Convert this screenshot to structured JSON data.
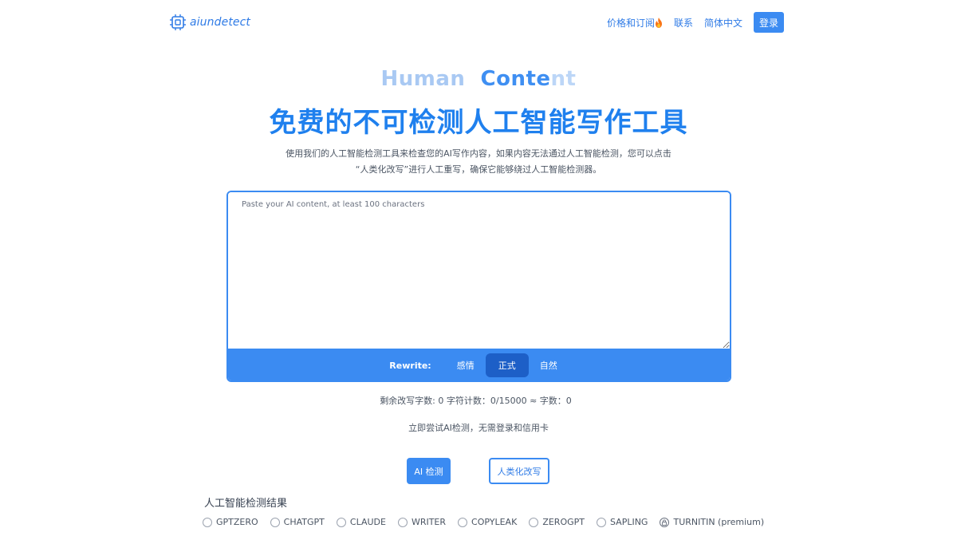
{
  "header": {
    "logo_text": "aiundetect",
    "nav": [
      {
        "label": "价格和订阅",
        "has_fire": true
      },
      {
        "label": "联系"
      },
      {
        "label": "简体中文"
      }
    ],
    "login_label": "登录"
  },
  "hero": {
    "subtitle_word1": "Human",
    "subtitle_word2a": "Conte",
    "subtitle_word2b": "nt",
    "title": "免费的不可检测人工智能写作工具",
    "desc_line1": "使用我们的人工智能检测工具来检查您的AI写作内容，如果内容无法通过人工智能检测，您可以点击",
    "desc_line2": "“人类化改写”进行人工重写，确保它能够绕过人工智能检测器。"
  },
  "editor": {
    "placeholder": "Paste your AI content, at least 100 characters",
    "rewrite_label": "Rewrite:",
    "modes": [
      "感情",
      "正式",
      "自然"
    ],
    "active_mode": "正式"
  },
  "counts_text": "剩余改写字数: 0   字符计数：0/15000 ≈ 字数：0",
  "try_note": "立即尝试AI检测，无需登录和信用卡",
  "buttons": {
    "detect": "AI 检测",
    "humanize": "人类化改写"
  },
  "results": {
    "title": "人工智能检测结果",
    "detectors": [
      "GPTZERO",
      "CHATGPT",
      "CLAUDE",
      "WRITER",
      "COPYLEAK",
      "ZEROGPT",
      "SAPLING",
      "TURNITIN (premium)"
    ]
  },
  "colors": {
    "primary": "#3b8bf2",
    "title_blue": "#1f80ee",
    "active_mode_bg": "#1d5fc7"
  }
}
